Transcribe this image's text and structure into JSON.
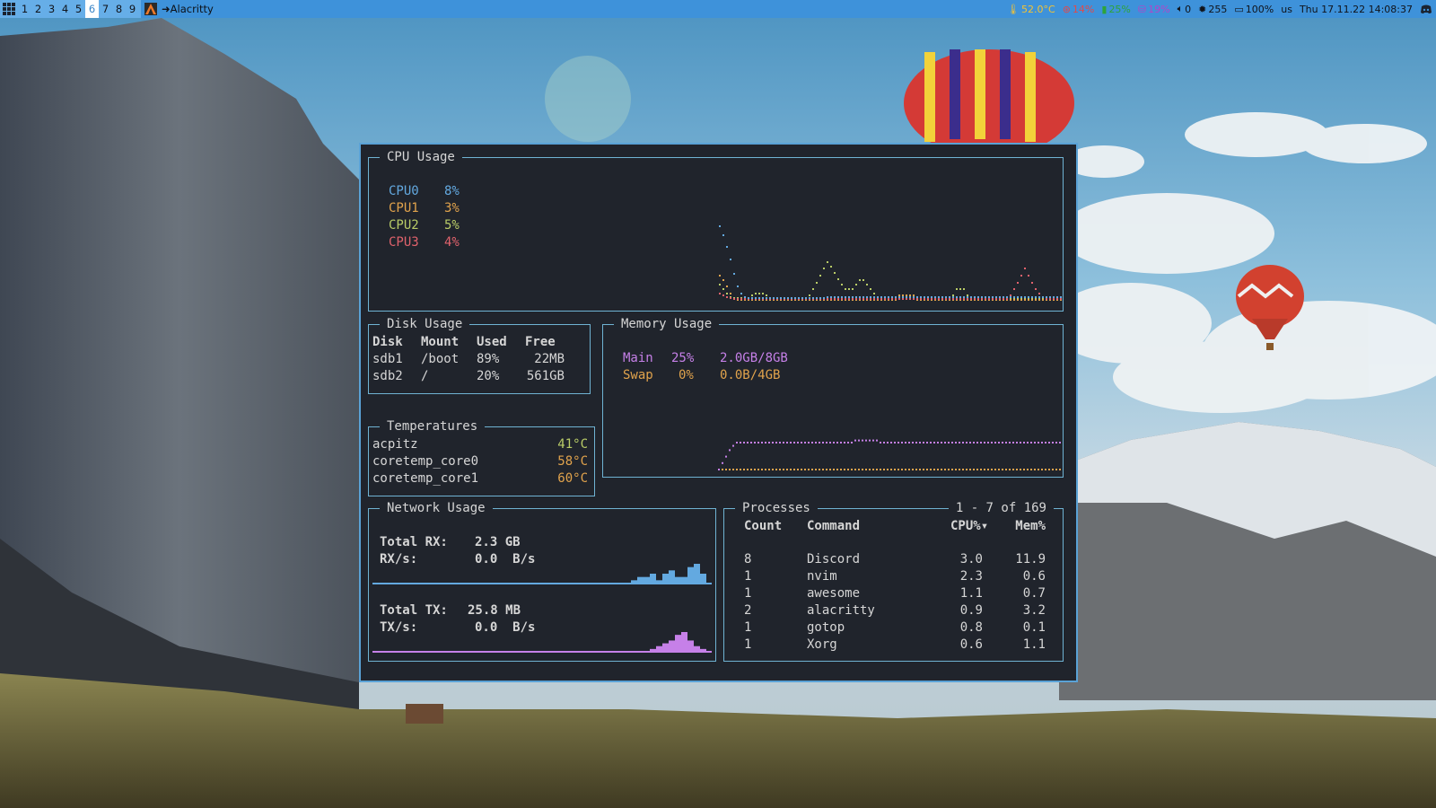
{
  "colors": {
    "topbar": "#66aee8",
    "active_tag": "#ffffff",
    "terminal_bg": "#20242c",
    "border": "#6fb3d3",
    "cpu0": "#63a9e0",
    "cpu1": "#e1a34c",
    "cpu2": "#b9cc67",
    "cpu3": "#e0626c",
    "memory_main": "#c680e8",
    "memory_swap": "#e1a34c",
    "rx": "#63a9e0",
    "tx": "#c680e8"
  },
  "topbar": {
    "launcher_icon": "grid-launcher-icon",
    "tags": [
      {
        "label": "1",
        "active": false
      },
      {
        "label": "2",
        "active": false
      },
      {
        "label": "3",
        "active": false
      },
      {
        "label": "4",
        "active": false
      },
      {
        "label": "5",
        "active": false
      },
      {
        "label": "6",
        "active": true
      },
      {
        "label": "7",
        "active": false
      },
      {
        "label": "8",
        "active": false
      },
      {
        "label": "9",
        "active": false
      }
    ],
    "task": {
      "icon": "alacritty-icon",
      "title": "Alacritty"
    },
    "widgets": {
      "temp": {
        "icon": "thermometer-icon",
        "text": "52.0°C"
      },
      "cpu": {
        "icon": "cpu-icon",
        "text": "14%"
      },
      "mem": {
        "icon": "memory-icon",
        "text": "25%"
      },
      "disk": {
        "icon": "disk-icon",
        "text": "19%"
      },
      "volume": {
        "icon": "speaker-icon",
        "text": "0"
      },
      "brightness": {
        "icon": "brightness-icon",
        "text": "255"
      },
      "battery": {
        "icon": "battery-icon",
        "text": "100%"
      },
      "layout": "us",
      "clock": "Thu 17.11.22 14:08:37",
      "tray": {
        "icon": "discord-icon"
      }
    }
  },
  "cpu": {
    "title": "CPU Usage",
    "rows": [
      {
        "name": "CPU0",
        "value": "8%"
      },
      {
        "name": "CPU1",
        "value": "3%"
      },
      {
        "name": "CPU2",
        "value": "5%"
      },
      {
        "name": "CPU3",
        "value": "4%"
      }
    ]
  },
  "disk": {
    "title": "Disk Usage",
    "headers": [
      "Disk",
      "Mount",
      "Used",
      "Free"
    ],
    "rows": [
      [
        "sdb1",
        "/boot",
        "89%",
        "22MB"
      ],
      [
        "sdb2",
        "/",
        "20%",
        "561GB"
      ]
    ]
  },
  "memory": {
    "title": "Memory Usage",
    "rows": [
      {
        "name": "Main",
        "pct": "25%",
        "amount": "2.0GB/8GB"
      },
      {
        "name": "Swap",
        "pct": "0%",
        "amount": "0.0B/4GB"
      }
    ]
  },
  "temps": {
    "title": "Temperatures",
    "rows": [
      {
        "name": "acpitz",
        "value": "41°C"
      },
      {
        "name": "coretemp_core0",
        "value": "58°C"
      },
      {
        "name": "coretemp_core1",
        "value": "60°C"
      }
    ]
  },
  "network": {
    "title": "Network Usage",
    "rx_total_label": "Total RX:",
    "rx_total": "2.3 GB",
    "rx_rate_label": "RX/s:",
    "rx_rate": "0.0  B/s",
    "tx_total_label": "Total TX:",
    "tx_total": "25.8 MB",
    "tx_rate_label": "TX/s:",
    "tx_rate": "0.0  B/s"
  },
  "processes": {
    "title": "Processes",
    "range": "1 - 7 of 169",
    "headers": {
      "count": "Count",
      "command": "Command",
      "cpu": "CPU%▾",
      "mem": "Mem%"
    },
    "rows": [
      {
        "count": "8",
        "command": "Discord",
        "cpu": "3.0",
        "mem": "11.9"
      },
      {
        "count": "1",
        "command": "nvim",
        "cpu": "2.3",
        "mem": "0.6"
      },
      {
        "count": "1",
        "command": "awesome",
        "cpu": "1.1",
        "mem": "0.7"
      },
      {
        "count": "2",
        "command": "alacritty",
        "cpu": "0.9",
        "mem": "3.2"
      },
      {
        "count": "1",
        "command": "gotop",
        "cpu": "0.8",
        "mem": "0.1"
      },
      {
        "count": "1",
        "command": "Xorg",
        "cpu": "0.6",
        "mem": "1.1"
      }
    ]
  },
  "cpu_history": {
    "cpu0": [
      85,
      75,
      62,
      48,
      32,
      18,
      10,
      6,
      5,
      5,
      5,
      5,
      5,
      5,
      5,
      5,
      5,
      5,
      5,
      5,
      5,
      5,
      5,
      5,
      5,
      5,
      5,
      5,
      5,
      5,
      6,
      6,
      6,
      6,
      6,
      6,
      6,
      6,
      6,
      6,
      6,
      6,
      6,
      6,
      6,
      6,
      6,
      6,
      6,
      6,
      6,
      6,
      6,
      6,
      6,
      6,
      6,
      6,
      6,
      6,
      6,
      6,
      6,
      6,
      6,
      6,
      6,
      6,
      6,
      6,
      6,
      6,
      6,
      6,
      6,
      6,
      6,
      6,
      6,
      6,
      6,
      6,
      6,
      6,
      6,
      6,
      6,
      6,
      6,
      6,
      6,
      6,
      6,
      6,
      6,
      6
    ],
    "cpu1": [
      30,
      25,
      18,
      10,
      5,
      3,
      3,
      3,
      3,
      3,
      3,
      3,
      3,
      3,
      3,
      3,
      3,
      3,
      3,
      3,
      3,
      3,
      3,
      3,
      3,
      3,
      3,
      3,
      3,
      3,
      3,
      3,
      3,
      3,
      3,
      3,
      3,
      3,
      3,
      3,
      3,
      3,
      3,
      3,
      3,
      3,
      3,
      3,
      3,
      3,
      8,
      8,
      8,
      8,
      8,
      3,
      3,
      3,
      3,
      3,
      3,
      3,
      3,
      3,
      3,
      3,
      3,
      3,
      3,
      3,
      3,
      3,
      3,
      3,
      3,
      3,
      3,
      3,
      3,
      3,
      3,
      3,
      3,
      3,
      3,
      3,
      3,
      3,
      3,
      3,
      3,
      3,
      3,
      3,
      3,
      3
    ],
    "cpu2": [
      20,
      15,
      10,
      6,
      5,
      5,
      5,
      5,
      5,
      8,
      10,
      10,
      10,
      8,
      5,
      5,
      5,
      5,
      5,
      5,
      5,
      5,
      5,
      5,
      5,
      8,
      15,
      22,
      30,
      38,
      45,
      40,
      33,
      26,
      20,
      15,
      15,
      15,
      20,
      25,
      25,
      20,
      15,
      10,
      5,
      5,
      5,
      5,
      5,
      5,
      5,
      5,
      5,
      5,
      5,
      5,
      5,
      5,
      5,
      5,
      5,
      5,
      5,
      5,
      5,
      8,
      15,
      15,
      15,
      8,
      5,
      5,
      5,
      5,
      5,
      5,
      5,
      5,
      5,
      5,
      5,
      5,
      5,
      5,
      5,
      5,
      5,
      5,
      5,
      5,
      5,
      5,
      5,
      5,
      5,
      5
    ],
    "cpu3": [
      10,
      8,
      6,
      5,
      4,
      4,
      4,
      4,
      4,
      4,
      4,
      4,
      4,
      4,
      4,
      4,
      4,
      4,
      4,
      4,
      4,
      4,
      4,
      4,
      4,
      4,
      4,
      4,
      4,
      4,
      4,
      4,
      4,
      4,
      4,
      4,
      4,
      4,
      4,
      4,
      4,
      4,
      4,
      4,
      4,
      4,
      4,
      4,
      4,
      4,
      4,
      4,
      4,
      4,
      4,
      4,
      4,
      4,
      4,
      4,
      4,
      4,
      4,
      4,
      4,
      4,
      4,
      4,
      4,
      4,
      4,
      4,
      4,
      4,
      4,
      4,
      4,
      4,
      4,
      4,
      4,
      8,
      15,
      22,
      30,
      38,
      30,
      22,
      15,
      10,
      6,
      4,
      4,
      4,
      4,
      4
    ]
  },
  "memory_history": {
    "main": [
      0,
      6,
      12,
      18,
      22,
      25,
      25,
      25,
      25,
      25,
      25,
      25,
      25,
      25,
      25,
      25,
      25,
      25,
      25,
      25,
      25,
      25,
      25,
      25,
      25,
      25,
      25,
      25,
      25,
      25,
      25,
      25,
      25,
      25,
      25,
      25,
      25,
      25,
      27,
      27,
      27,
      27,
      27,
      27,
      27,
      25,
      25,
      25,
      25,
      25,
      25,
      25,
      25,
      25,
      25,
      25,
      25,
      25,
      25,
      25,
      25,
      25,
      25,
      25,
      25,
      25,
      25,
      25,
      25,
      25,
      25,
      25,
      25,
      25,
      25,
      25,
      25,
      25,
      25,
      25,
      25,
      25,
      25,
      25,
      25,
      25,
      25,
      25,
      25,
      25,
      25,
      25,
      25,
      25,
      25,
      25
    ],
    "swap": [
      0,
      0,
      0,
      0,
      0,
      0,
      0,
      0,
      0,
      0,
      0,
      0,
      0,
      0,
      0,
      0,
      0,
      0,
      0,
      0,
      0,
      0,
      0,
      0,
      0,
      0,
      0,
      0,
      0,
      0,
      0,
      0,
      0,
      0,
      0,
      0,
      0,
      0,
      0,
      0,
      0,
      0,
      0,
      0,
      0,
      0,
      0,
      0,
      0,
      0,
      0,
      0,
      0,
      0,
      0,
      0,
      0,
      0,
      0,
      0,
      0,
      0,
      0,
      0,
      0,
      0,
      0,
      0,
      0,
      0,
      0,
      0,
      0,
      0,
      0,
      0,
      0,
      0,
      0,
      0,
      0,
      0,
      0,
      0,
      0,
      0,
      0,
      0,
      0,
      0,
      0,
      0,
      0,
      0,
      0,
      0
    ]
  },
  "rx_history": [
    1,
    2,
    2,
    3,
    1,
    3,
    4,
    2,
    2,
    5,
    6,
    3
  ],
  "tx_history": [
    1,
    2,
    3,
    4,
    6,
    7,
    4,
    2,
    1
  ]
}
